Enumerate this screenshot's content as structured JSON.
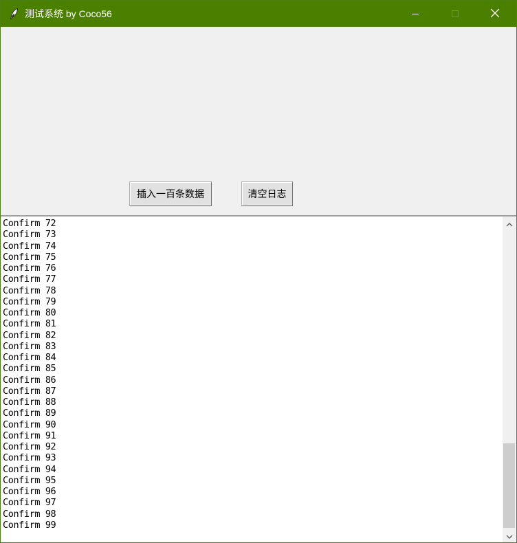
{
  "window": {
    "title": "测试系统 by Coco56",
    "titlebar_color": "#4a7f00",
    "icon": "feather-icon",
    "controls": [
      "minimize-icon",
      "maximize-icon",
      "close-icon"
    ]
  },
  "toolbar": {
    "insert_label": "插入一百条数据",
    "clear_label": "清空日志"
  },
  "log": {
    "lines": [
      "Confirm 72",
      "Confirm 73",
      "Confirm 74",
      "Confirm 75",
      "Confirm 76",
      "Confirm 77",
      "Confirm 78",
      "Confirm 79",
      "Confirm 80",
      "Confirm 81",
      "Confirm 82",
      "Confirm 83",
      "Confirm 84",
      "Confirm 85",
      "Confirm 86",
      "Confirm 87",
      "Confirm 88",
      "Confirm 89",
      "Confirm 90",
      "Confirm 91",
      "Confirm 92",
      "Confirm 93",
      "Confirm 94",
      "Confirm 95",
      "Confirm 96",
      "Confirm 97",
      "Confirm 98",
      "Confirm 99"
    ]
  },
  "scrollbar": {
    "icons": [
      "chevron-up-icon",
      "chevron-down-icon"
    ],
    "scroll_position_fraction": 1.0
  }
}
